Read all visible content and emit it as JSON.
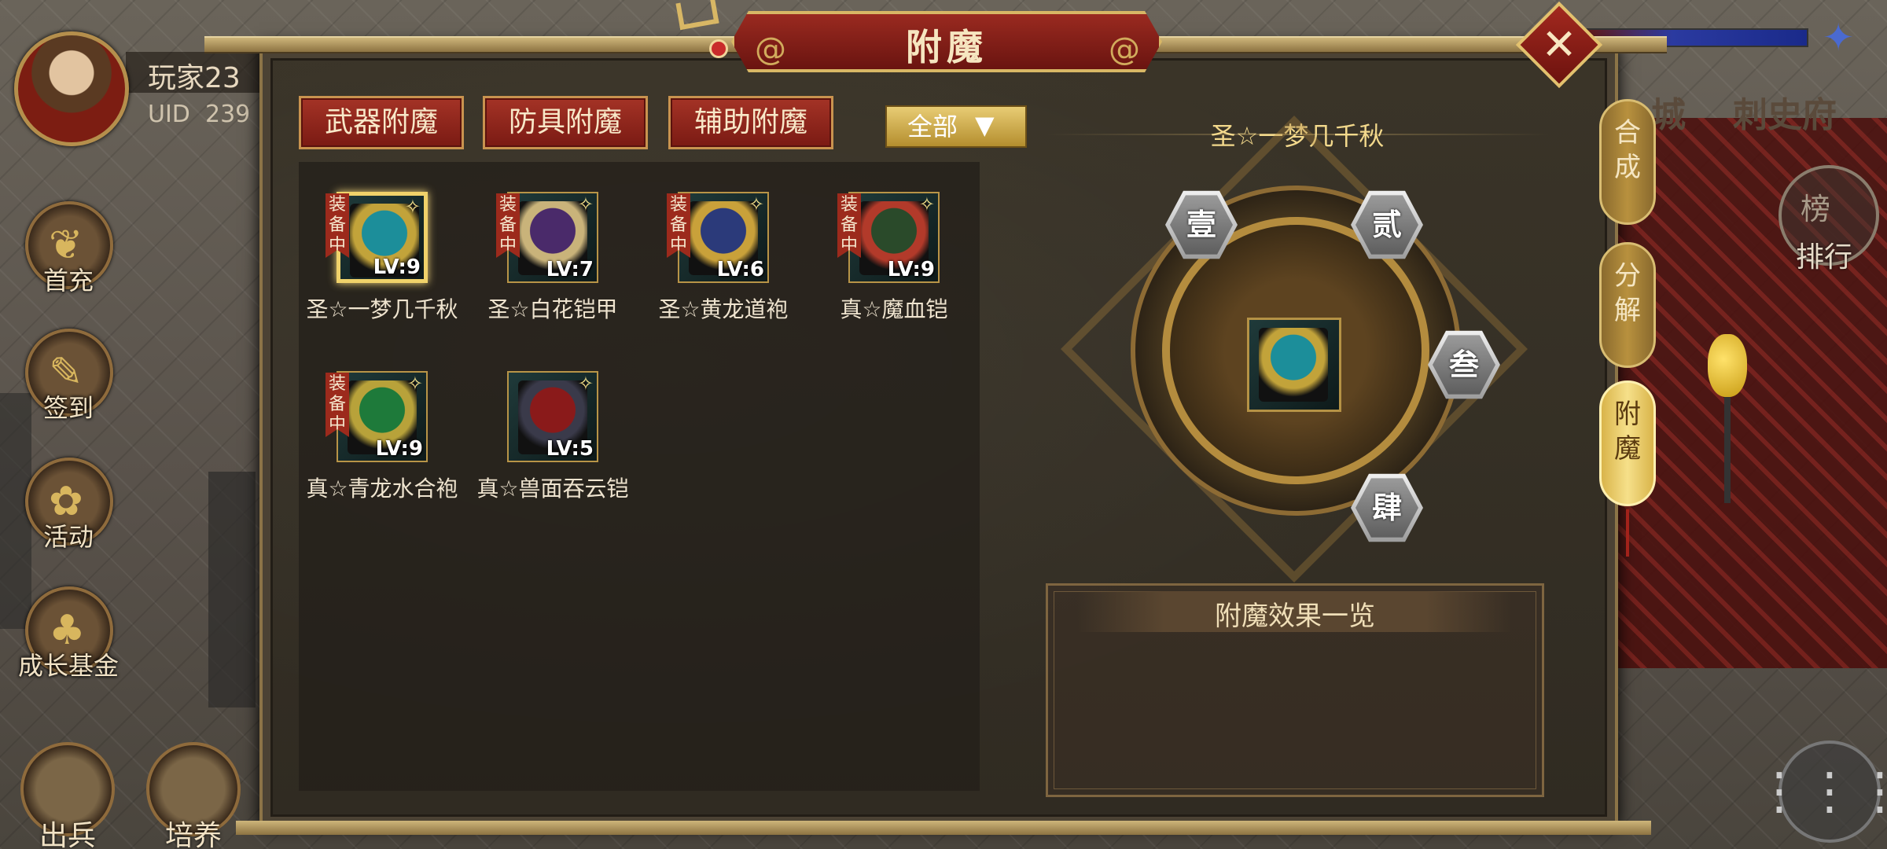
{
  "player": {
    "name": "玩家23",
    "uid_label": "UID",
    "uid_value": "239"
  },
  "left_menu": [
    {
      "label": "首充",
      "icon": "gift-pouch-icon"
    },
    {
      "label": "签到",
      "icon": "scroll-brush-icon"
    },
    {
      "label": "活动",
      "icon": "treasure-icon"
    },
    {
      "label": "成长基金",
      "icon": "money-tree-icon"
    }
  ],
  "bottom_menu": [
    {
      "label": "出兵",
      "icon": "troops-icon"
    },
    {
      "label": "培养",
      "icon": "train-icon"
    }
  ],
  "city_labels": [
    "城",
    "刺史府"
  ],
  "rank": {
    "label": "排行",
    "icon_text": "榜"
  },
  "modal": {
    "title": "附魔",
    "close_icon": "close-icon"
  },
  "tabs": [
    {
      "label": "武器附魔"
    },
    {
      "label": "防具附魔"
    },
    {
      "label": "辅助附魔"
    }
  ],
  "filter": {
    "selected": "全部",
    "arrow": "▼"
  },
  "items": [
    {
      "name": "圣☆一梦几千秋",
      "level": "LV:9",
      "equipped": true,
      "equipped_label": "装备中",
      "selected": true,
      "colors": [
        "#1c8e9a",
        "#c2a33a"
      ]
    },
    {
      "name": "圣☆白花铠甲",
      "level": "LV:7",
      "equipped": true,
      "equipped_label": "装备中",
      "selected": false,
      "colors": [
        "#4a2a6a",
        "#c9b37a"
      ]
    },
    {
      "name": "圣☆黄龙道袍",
      "level": "LV:6",
      "equipped": true,
      "equipped_label": "装备中",
      "selected": false,
      "colors": [
        "#2b3a7a",
        "#c9a13a"
      ]
    },
    {
      "name": "真☆魔血铠",
      "level": "LV:9",
      "equipped": true,
      "equipped_label": "装备中",
      "selected": false,
      "colors": [
        "#2a4a2a",
        "#b23a2a"
      ]
    },
    {
      "name": "真☆青龙水合袍",
      "level": "LV:9",
      "equipped": true,
      "equipped_label": "装备中",
      "selected": false,
      "colors": [
        "#1e7a3a",
        "#b8a23a"
      ]
    },
    {
      "name": "真☆兽面吞云铠",
      "level": "LV:5",
      "equipped": false,
      "equipped_label": "",
      "selected": false,
      "colors": [
        "#8a1a1a",
        "#3a3a4a"
      ]
    }
  ],
  "enchant": {
    "selected_item": "圣☆一梦几千秋",
    "slots": [
      "壹",
      "贰",
      "叁",
      "肆"
    ],
    "effects_title": "附魔效果一览"
  },
  "side_tabs": [
    {
      "label": "合\n成",
      "active": false
    },
    {
      "label": "分\n解",
      "active": false
    },
    {
      "label": "附\n魔",
      "active": true
    }
  ],
  "menu_icon": "menu-icon"
}
